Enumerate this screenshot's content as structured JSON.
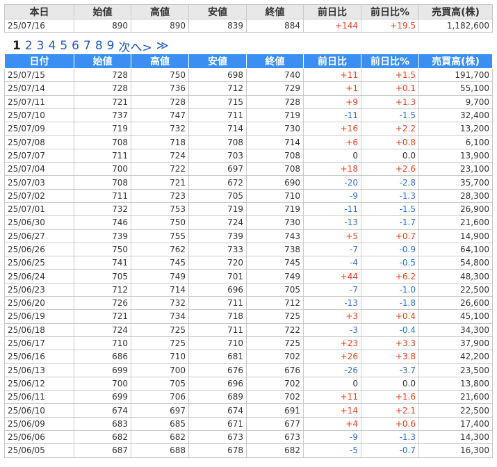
{
  "columns": [
    "本日",
    "始値",
    "高値",
    "安値",
    "終値",
    "前日比",
    "前日比%",
    "売買高(株)"
  ],
  "today": {
    "date": "25/07/16",
    "open": "890",
    "high": "890",
    "low": "839",
    "close": "884",
    "change": "+144",
    "change_pct": "+19.5",
    "volume": "1,182,600"
  },
  "pager": {
    "current": "1",
    "pages": [
      "2",
      "3",
      "4",
      "5",
      "6",
      "7",
      "8",
      "9"
    ],
    "next": "次へ>",
    "last": "≫"
  },
  "history_columns": [
    "日付",
    "始値",
    "高値",
    "安値",
    "終値",
    "前日比",
    "前日比%",
    "売買高(株)"
  ],
  "history": [
    {
      "date": "25/07/15",
      "open": "728",
      "high": "750",
      "low": "698",
      "close": "740",
      "change": "+11",
      "change_pct": "+1.5",
      "volume": "191,700"
    },
    {
      "date": "25/07/14",
      "open": "728",
      "high": "736",
      "low": "712",
      "close": "729",
      "change": "+1",
      "change_pct": "+0.1",
      "volume": "55,100"
    },
    {
      "date": "25/07/11",
      "open": "721",
      "high": "728",
      "low": "715",
      "close": "728",
      "change": "+9",
      "change_pct": "+1.3",
      "volume": "9,700"
    },
    {
      "date": "25/07/10",
      "open": "737",
      "high": "747",
      "low": "711",
      "close": "719",
      "change": "-11",
      "change_pct": "-1.5",
      "volume": "32,400"
    },
    {
      "date": "25/07/09",
      "open": "719",
      "high": "732",
      "low": "714",
      "close": "730",
      "change": "+16",
      "change_pct": "+2.2",
      "volume": "13,200"
    },
    {
      "date": "25/07/08",
      "open": "708",
      "high": "718",
      "low": "708",
      "close": "714",
      "change": "+6",
      "change_pct": "+0.8",
      "volume": "6,100"
    },
    {
      "date": "25/07/07",
      "open": "711",
      "high": "724",
      "low": "703",
      "close": "708",
      "change": "0",
      "change_pct": "0.0",
      "volume": "13,900"
    },
    {
      "date": "25/07/04",
      "open": "700",
      "high": "722",
      "low": "697",
      "close": "708",
      "change": "+18",
      "change_pct": "+2.6",
      "volume": "23,100"
    },
    {
      "date": "25/07/03",
      "open": "708",
      "high": "721",
      "low": "672",
      "close": "690",
      "change": "-20",
      "change_pct": "-2.8",
      "volume": "35,700"
    },
    {
      "date": "25/07/02",
      "open": "711",
      "high": "723",
      "low": "705",
      "close": "710",
      "change": "-9",
      "change_pct": "-1.3",
      "volume": "28,300"
    },
    {
      "date": "25/07/01",
      "open": "732",
      "high": "753",
      "low": "719",
      "close": "719",
      "change": "-11",
      "change_pct": "-1.5",
      "volume": "26,900"
    },
    {
      "date": "25/06/30",
      "open": "746",
      "high": "750",
      "low": "724",
      "close": "730",
      "change": "-13",
      "change_pct": "-1.7",
      "volume": "21,600"
    },
    {
      "date": "25/06/27",
      "open": "739",
      "high": "755",
      "low": "739",
      "close": "743",
      "change": "+5",
      "change_pct": "+0.7",
      "volume": "14,900"
    },
    {
      "date": "25/06/26",
      "open": "750",
      "high": "762",
      "low": "733",
      "close": "738",
      "change": "-7",
      "change_pct": "-0.9",
      "volume": "64,100"
    },
    {
      "date": "25/06/25",
      "open": "741",
      "high": "745",
      "low": "720",
      "close": "745",
      "change": "-4",
      "change_pct": "-0.5",
      "volume": "54,800"
    },
    {
      "date": "25/06/24",
      "open": "705",
      "high": "749",
      "low": "701",
      "close": "749",
      "change": "+44",
      "change_pct": "+6.2",
      "volume": "48,300"
    },
    {
      "date": "25/06/23",
      "open": "712",
      "high": "714",
      "low": "696",
      "close": "705",
      "change": "-7",
      "change_pct": "-1.0",
      "volume": "22,500"
    },
    {
      "date": "25/06/20",
      "open": "726",
      "high": "732",
      "low": "711",
      "close": "712",
      "change": "-13",
      "change_pct": "-1.8",
      "volume": "26,600"
    },
    {
      "date": "25/06/19",
      "open": "721",
      "high": "734",
      "low": "718",
      "close": "725",
      "change": "+3",
      "change_pct": "+0.4",
      "volume": "45,100"
    },
    {
      "date": "25/06/18",
      "open": "724",
      "high": "725",
      "low": "711",
      "close": "722",
      "change": "-3",
      "change_pct": "-0.4",
      "volume": "34,300"
    },
    {
      "date": "25/06/17",
      "open": "710",
      "high": "725",
      "low": "710",
      "close": "725",
      "change": "+23",
      "change_pct": "+3.3",
      "volume": "37,900"
    },
    {
      "date": "25/06/16",
      "open": "686",
      "high": "710",
      "low": "681",
      "close": "702",
      "change": "+26",
      "change_pct": "+3.8",
      "volume": "42,200"
    },
    {
      "date": "25/06/13",
      "open": "699",
      "high": "700",
      "low": "676",
      "close": "676",
      "change": "-26",
      "change_pct": "-3.7",
      "volume": "23,500"
    },
    {
      "date": "25/06/12",
      "open": "700",
      "high": "705",
      "low": "696",
      "close": "702",
      "change": "0",
      "change_pct": "0.0",
      "volume": "13,800"
    },
    {
      "date": "25/06/11",
      "open": "699",
      "high": "706",
      "low": "689",
      "close": "702",
      "change": "+11",
      "change_pct": "+1.6",
      "volume": "21,600"
    },
    {
      "date": "25/06/10",
      "open": "674",
      "high": "697",
      "low": "674",
      "close": "691",
      "change": "+14",
      "change_pct": "+2.1",
      "volume": "22,500"
    },
    {
      "date": "25/06/09",
      "open": "683",
      "high": "685",
      "low": "671",
      "close": "677",
      "change": "+4",
      "change_pct": "+0.6",
      "volume": "17,400"
    },
    {
      "date": "25/06/06",
      "open": "682",
      "high": "682",
      "low": "673",
      "close": "673",
      "change": "-9",
      "change_pct": "-1.3",
      "volume": "14,300"
    },
    {
      "date": "25/06/05",
      "open": "687",
      "high": "688",
      "low": "678",
      "close": "682",
      "change": "-5",
      "change_pct": "-0.7",
      "volume": "16,300"
    }
  ],
  "colors": {
    "header_blue": "#3b8ff3",
    "header_gray": "#e8e8e8",
    "positive": "#e8401c",
    "negative": "#2a6fd6",
    "link": "#1c55c2"
  }
}
